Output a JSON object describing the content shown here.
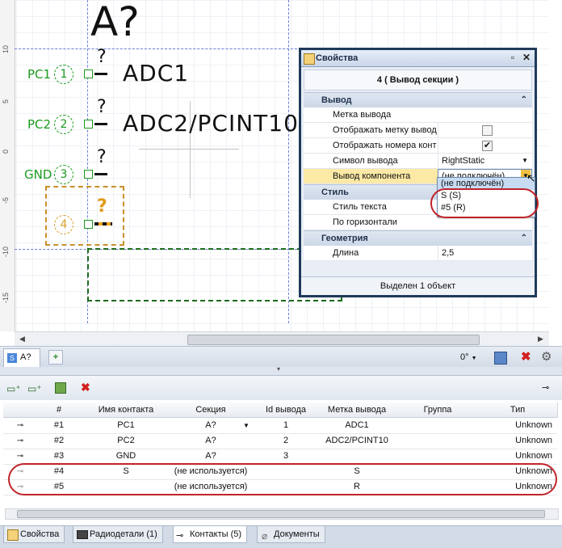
{
  "schematic": {
    "component_title": "A?",
    "pins": [
      {
        "net": "PC1",
        "num": "1",
        "label": "ADC1",
        "q": "?"
      },
      {
        "net": "PC2",
        "num": "2",
        "label": "ADC2/PCINT10",
        "q": "?"
      },
      {
        "net": "GND",
        "num": "3",
        "label": "",
        "q": "?"
      },
      {
        "net": "",
        "num": "4",
        "label": "",
        "q": "?"
      }
    ],
    "ruler_labels": [
      "10",
      "5",
      "0",
      "-5",
      "-10",
      "-15"
    ]
  },
  "properties": {
    "title": "Свойства",
    "header": "4 ( Вывод секции )",
    "cat_output": "Вывод",
    "rows_output": [
      {
        "name": "Метка вывода",
        "value": ""
      },
      {
        "name": "Отображать метку вывод",
        "value": ""
      },
      {
        "name": "Отображать номера конт",
        "value": "✔"
      },
      {
        "name": "Символ вывода",
        "value": "RightStatic"
      },
      {
        "name": "Вывод компонента",
        "value": "(не подключён)"
      }
    ],
    "cat_style": "Стиль",
    "rows_style": [
      {
        "name": "Стиль текста",
        "value": ""
      },
      {
        "name": "По горизонтали",
        "value": ""
      }
    ],
    "cat_geometry": "Геометрия",
    "rows_geometry": [
      {
        "name": "Длина",
        "value": "2,5"
      }
    ],
    "footer": "Выделен 1 объект",
    "dropdown": [
      "(не подключён)",
      "S (S)",
      "#5 (R)"
    ]
  },
  "doc_tab": {
    "label": "A?"
  },
  "toolbar": {
    "rotation": "0°"
  },
  "table": {
    "columns": [
      "#",
      "Имя контакта",
      "Секция",
      "Id вывода",
      "Метка вывода",
      "Группа",
      "Тип"
    ],
    "rows": [
      {
        "n": "#1",
        "name": "PC1",
        "section": "A?",
        "id": "1",
        "label": "ADC1",
        "group": "",
        "type": "Unknown"
      },
      {
        "n": "#2",
        "name": "PC2",
        "section": "A?",
        "id": "2",
        "label": "ADC2/PCINT10",
        "group": "",
        "type": "Unknown"
      },
      {
        "n": "#3",
        "name": "GND",
        "section": "A?",
        "id": "3",
        "label": "",
        "group": "",
        "type": "Unknown"
      },
      {
        "n": "#4",
        "name": "S",
        "section": "(не используется)",
        "id": "",
        "label": "S",
        "group": "",
        "type": "Unknown"
      },
      {
        "n": "#5",
        "name": "",
        "section": "(не используется)",
        "id": "",
        "label": "R",
        "group": "",
        "type": "Unknown"
      }
    ]
  },
  "bottom_tabs": [
    "Свойства",
    "Радиодетали (1)",
    "Контакты (5)",
    "Документы"
  ]
}
